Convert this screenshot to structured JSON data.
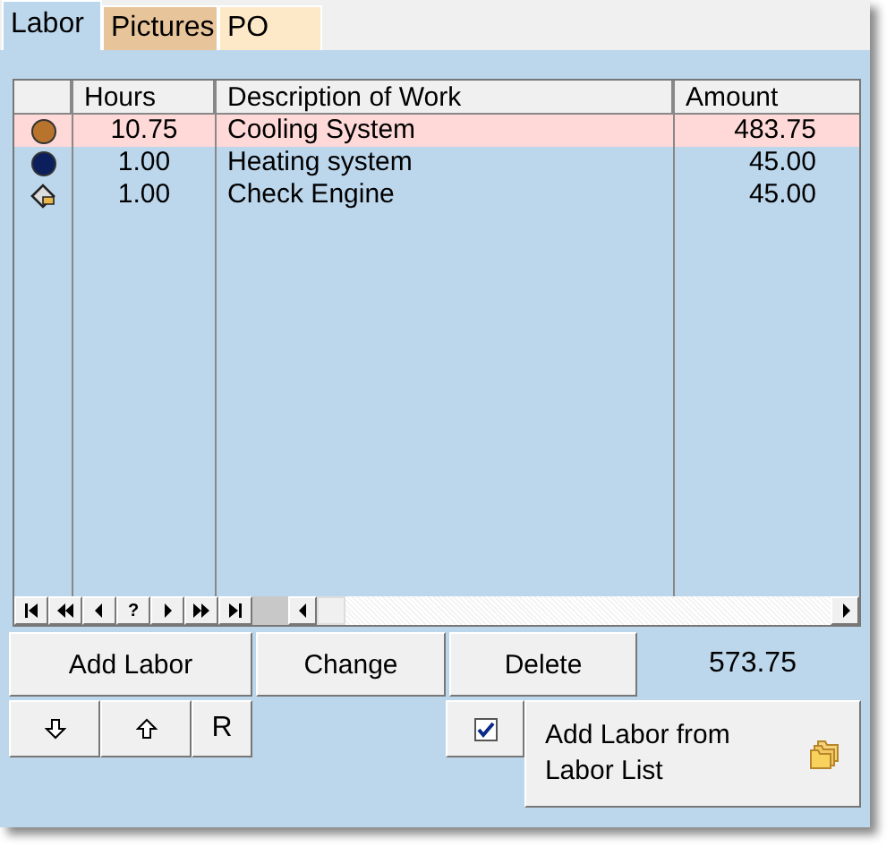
{
  "tabs": [
    {
      "label": "Labor",
      "selected": true
    },
    {
      "label": "Pictures",
      "selected": false
    },
    {
      "label": "PO",
      "selected": false
    }
  ],
  "table": {
    "columns": [
      "Hours",
      "Description of Work",
      "Amount"
    ],
    "rows": [
      {
        "kind": "dot",
        "color": "#b8742c",
        "hours": "10.75",
        "description": "Cooling System",
        "amount": "483.75",
        "selected": true
      },
      {
        "kind": "dot",
        "color": "#0b1f5c",
        "hours": "1.00",
        "description": "Heating system",
        "amount": "45.00",
        "selected": false
      },
      {
        "kind": "tag",
        "hours": "1.00",
        "description": "Check Engine",
        "amount": "45.00",
        "selected": false
      }
    ]
  },
  "navigator": {
    "help": "?"
  },
  "buttons": {
    "add": "Add Labor",
    "change": "Change",
    "delete": "Delete",
    "reset": "R",
    "add_from_list": "Add Labor from Labor List"
  },
  "total": "573.75",
  "option_checked": true
}
